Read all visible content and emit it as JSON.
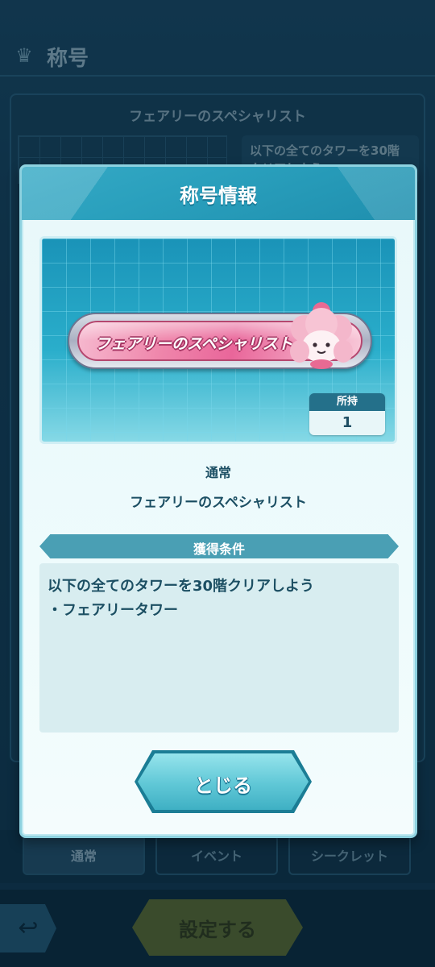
{
  "background": {
    "header_title": "称号",
    "header_icon": "title-badge-icon",
    "panel_title": "フェアリーのスペシャリスト",
    "panel_desc": "以下の全てのタワーを30階クリアしよう",
    "tabs": [
      {
        "label": "通常",
        "active": true
      },
      {
        "label": "イベント",
        "active": false
      },
      {
        "label": "シークレット",
        "active": false
      }
    ],
    "back_icon": "back-arrow-icon",
    "set_button_label": "設定する"
  },
  "modal": {
    "title": "称号情報",
    "plate_text": "フェアリーのスペシャリスト",
    "count_label": "所持",
    "count_value": "1",
    "rarity": "通常",
    "title_name": "フェアリーのスペシャリスト",
    "condition_header": "獲得条件",
    "condition_text": "以下の全てのタワーを30階クリアしよう",
    "condition_items": [
      "・フェアリータワー"
    ],
    "close_label": "とじる"
  },
  "colors": {
    "accent": "#2aa0bd",
    "text_dark": "#1b4e63",
    "plate_pink": "#e9669a"
  }
}
